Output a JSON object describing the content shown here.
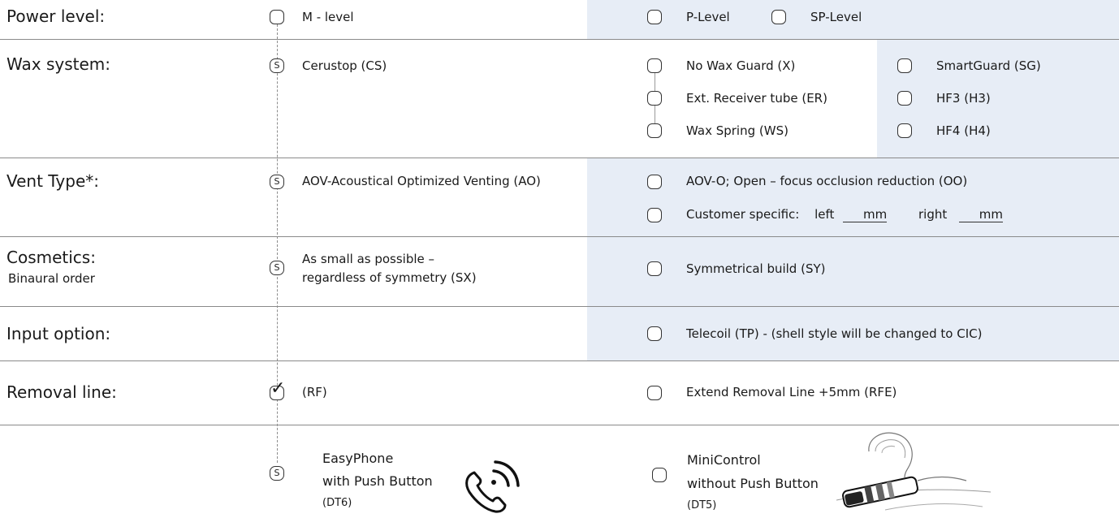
{
  "rows": {
    "power": {
      "label": "Power level:",
      "std": "M - level",
      "opt1": "P-Level",
      "opt2": "SP-Level"
    },
    "wax": {
      "label": "Wax system:",
      "std": "Cerustop (CS)",
      "badge": "S",
      "opts_mid": [
        "No Wax Guard (X)",
        "Ext. Receiver tube (ER)",
        "Wax Spring (WS)"
      ],
      "opts_right": [
        "SmartGuard (SG)",
        "HF3 (H3)",
        "HF4 (H4)"
      ]
    },
    "vent": {
      "label": "Vent Type*:",
      "std": "AOV-Acoustical Optimized Venting (AO)",
      "badge": "S",
      "opt1": "AOV-O;  Open – focus occlusion reduction (OO)",
      "custom_label": "Customer specific:",
      "left_label": "left",
      "right_label": "right",
      "unit": "mm"
    },
    "cosmetics": {
      "label": "Cosmetics:",
      "sublabel": "Binaural order",
      "std_line1": "As small as possible –",
      "std_line2": "regardless of symmetry (SX)",
      "badge": "S",
      "opt1": "Symmetrical build (SY)"
    },
    "input": {
      "label": "Input option:",
      "opt1": "Telecoil (TP) - (shell style will be changed to CIC)"
    },
    "removal": {
      "label": "Removal line:",
      "std": "(RF)",
      "check": "✓",
      "opt1": "Extend Removal Line  +5mm (RFE)"
    },
    "control": {
      "badge": "S",
      "std_line1": "EasyPhone",
      "std_line2": "with Push Button",
      "std_code": "(DT6)",
      "opt_line1": "MiniControl",
      "opt_line2": "without Push Button",
      "opt_code": "(DT5)"
    }
  },
  "colors": {
    "shade": "#e7edf6",
    "line": "#8a8a8a"
  }
}
